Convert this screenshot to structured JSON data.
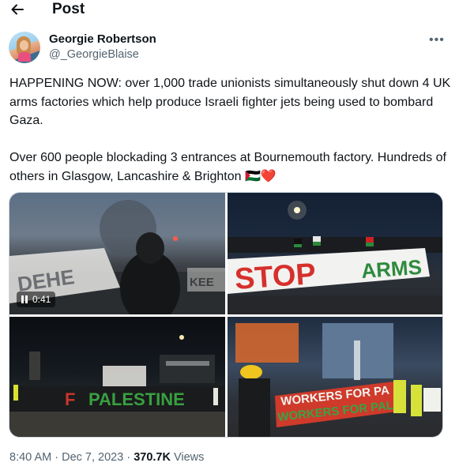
{
  "header": {
    "title": "Post",
    "back_icon": "arrow-left-icon"
  },
  "author": {
    "name": "Georgie Robertson",
    "handle": "@_GeorgieBlaise",
    "more_icon": "more-horizontal-icon"
  },
  "tweet": {
    "para1": "HAPPENING NOW: over 1,000 trade unionists simultaneously shut down 4 UK arms factories which help produce Israeli fighter jets being used to bombard Gaza.",
    "para2": "Over 600 people blockading 3 entrances at Bournemouth factory. Hundreds of others in Glasgow, Lancashire & Brighton 🇵🇸❤️"
  },
  "media": {
    "video_duration": "0:41",
    "banner_stop": "STOP",
    "banner_arms": "ARMS",
    "banner_palestine": "PALESTINE",
    "banner_workers": "WORKERS FOR PA",
    "banner_workers2": "WORKERS FOR PAL"
  },
  "meta": {
    "time": "8:40 AM",
    "date": "Dec 7, 2023",
    "views_count": "370.7K",
    "views_label": "Views"
  },
  "colors": {
    "text": "#0f1419",
    "muted": "#536471",
    "border": "#cfd9de"
  }
}
